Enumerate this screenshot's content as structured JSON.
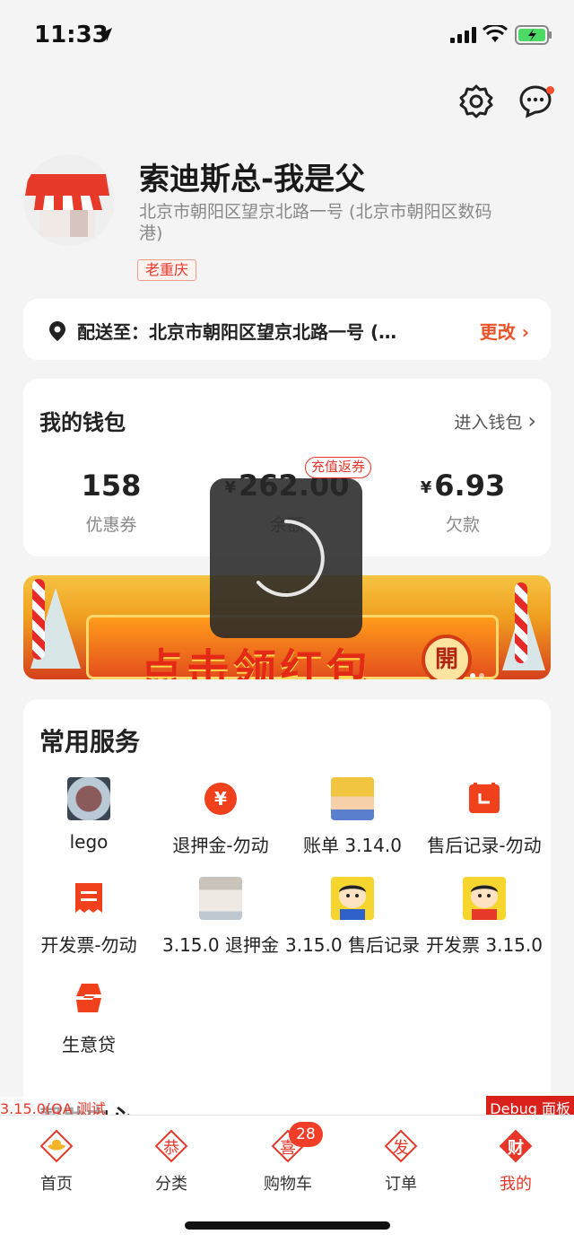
{
  "status_bar": {
    "time": "11:33"
  },
  "header": {
    "settings_icon": "gear-icon",
    "message_icon": "chat-bubble-icon"
  },
  "store": {
    "name": "索迪斯总-我是父",
    "address": "北京市朝阳区望京北路一号 (北京市朝阳区数码港)",
    "tag": "老重庆"
  },
  "delivery": {
    "label": "配送至：北京市朝阳区望京北路一号 (北京市朝阳区数码港)",
    "change": "更改"
  },
  "wallet": {
    "title": "我的钱包",
    "enter": "进入钱包",
    "recharge_badge": "充值返券",
    "currency": "¥",
    "items": [
      {
        "value": "158",
        "label": "优惠券"
      },
      {
        "value": "262.00",
        "label": "余额"
      },
      {
        "value": "6.93",
        "label": "欠款"
      }
    ]
  },
  "banner": {
    "text": "点击领红包",
    "button": "開"
  },
  "services": {
    "title": "常用服务",
    "items": [
      {
        "label": "lego",
        "icon": "lego-photo-icon"
      },
      {
        "label": "退押金-勿动",
        "icon": "yen-circle-icon"
      },
      {
        "label": "账单 3.14.0",
        "icon": "baby-photo-icon"
      },
      {
        "label": "售后记录-勿动",
        "icon": "calendar-icon"
      },
      {
        "label": "开发票-勿动",
        "icon": "invoice-icon"
      },
      {
        "label": "3.15.0 退押金",
        "icon": "baby-photo-icon"
      },
      {
        "label": "3.15.0 售后记录",
        "icon": "cartoon-boy-icon"
      },
      {
        "label": "开发票 3.15.0",
        "icon": "cartoon-boy-icon"
      },
      {
        "label": "生意贷",
        "icon": "loan-s-icon"
      }
    ]
  },
  "help": {
    "title": "帮助中心"
  },
  "debug": {
    "version": "3.15.0(QA 测试",
    "panel": "Debug 面板"
  },
  "tabbar": {
    "cart_badge": "28",
    "tabs": [
      {
        "label": "首页",
        "glyph": ""
      },
      {
        "label": "分类",
        "glyph": "恭"
      },
      {
        "label": "购物车",
        "glyph": "喜"
      },
      {
        "label": "订单",
        "glyph": "发"
      },
      {
        "label": "我的",
        "glyph": "财"
      }
    ]
  },
  "colors": {
    "accent": "#e8372a",
    "background": "#f4f4f4",
    "card": "#ffffff"
  }
}
